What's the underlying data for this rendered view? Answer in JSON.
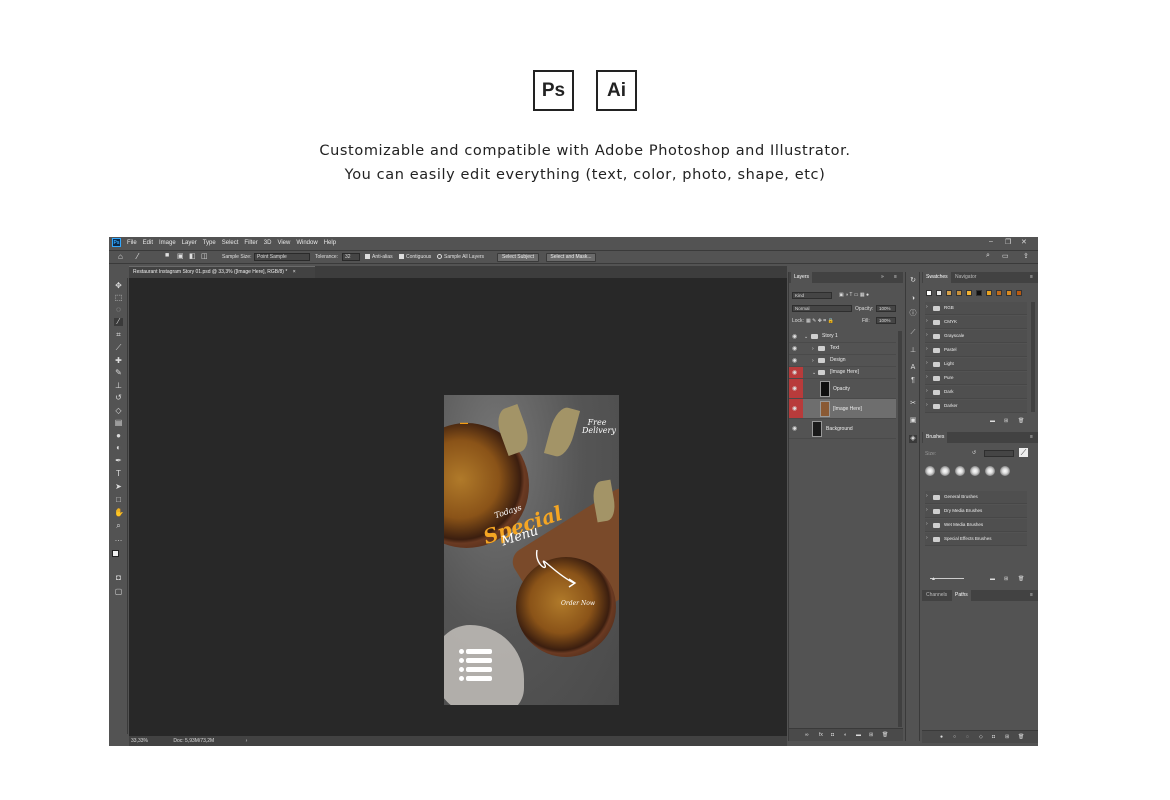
{
  "header": {
    "badges": [
      "Ps",
      "Ai"
    ],
    "line1": "Customizable and compatible with Adobe Photoshop and Illustrator.",
    "line2": "You can easily edit everything (text, color, photo, shape, etc)"
  },
  "app": {
    "logo": "Ps",
    "menu": [
      "File",
      "Edit",
      "Image",
      "Layer",
      "Type",
      "Select",
      "Filter",
      "3D",
      "View",
      "Window",
      "Help"
    ]
  },
  "options_bar": {
    "sample_size_label": "Sample Size:",
    "sample_size_value": "Point Sample",
    "tolerance_label": "Tolerance:",
    "tolerance_value": "32",
    "anti_alias": "Anti-alias",
    "contiguous": "Contiguous",
    "sample_all_layers": "Sample All Layers",
    "select_subject": "Select Subject",
    "select_and_mask": "Select and Mask..."
  },
  "document": {
    "tab_title": "Restaurant Instagram Story 01.psd @ 33,3% ([Image Here], RGB/8) *",
    "zoom": "33,33%",
    "doc_size": "Doc: 5,93M/73,2M"
  },
  "artwork": {
    "free": "Free",
    "delivery": "Delivery",
    "todays": "Todays",
    "special": "Special",
    "menu": "Menu",
    "order_now": "Order Now"
  },
  "layers_panel": {
    "tab": "Layers",
    "kind": "Kind",
    "blend_mode": "Normal",
    "opacity_label": "Opacity:",
    "opacity_value": "100%",
    "lock_label": "Lock:",
    "fill_label": "Fill:",
    "fill_value": "100%",
    "layers": [
      {
        "name": "Story 1"
      },
      {
        "name": "Text"
      },
      {
        "name": "Design"
      },
      {
        "name": "[Image Here]"
      },
      {
        "name": "Opacity"
      },
      {
        "name": "[Image Here]"
      },
      {
        "name": "Background"
      }
    ]
  },
  "swatches_panel": {
    "tabs": [
      "Swatches",
      "Navigator"
    ],
    "colors": [
      "#ffffff",
      "#e8e8e8",
      "#d7a24a",
      "#c9913a",
      "#f2b233",
      "#111111",
      "#e8a220",
      "#c06b1a",
      "#d98a20",
      "#b85a10"
    ],
    "groups": [
      "RGB",
      "CMYK",
      "Grayscale",
      "Pastel",
      "Light",
      "Pure",
      "Dark",
      "Darker"
    ]
  },
  "brushes_panel": {
    "tab": "Brushes",
    "size_label": "Size:",
    "groups": [
      "General Brushes",
      "Dry Media Brushes",
      "Wet Media Brushes",
      "Special Effects Brushes"
    ]
  },
  "channels_panel": {
    "tabs": [
      "Channels",
      "Paths"
    ]
  }
}
